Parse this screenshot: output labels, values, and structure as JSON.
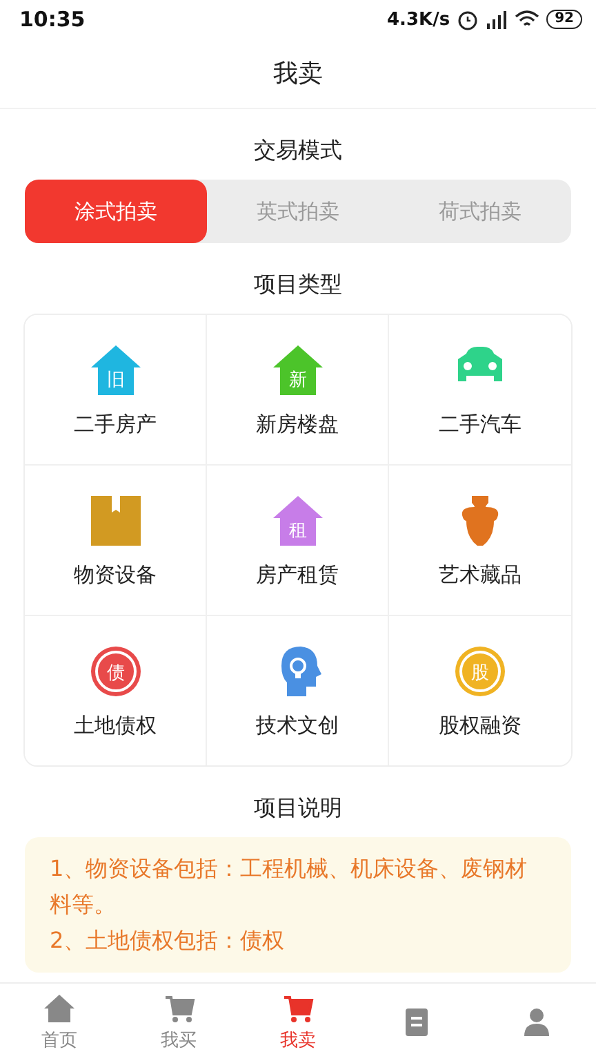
{
  "status_bar": {
    "time": "10:35",
    "speed": "4.3K/s",
    "battery": "92"
  },
  "title": "我卖",
  "mode_section": {
    "title": "交易模式",
    "options": [
      {
        "label": "涂式拍卖",
        "selected": true
      },
      {
        "label": "英式拍卖",
        "selected": false
      },
      {
        "label": "荷式拍卖",
        "selected": false
      }
    ]
  },
  "type_section": {
    "title": "项目类型",
    "items": [
      {
        "label": "二手房产",
        "kind": "house",
        "glyph": "旧",
        "color": "#1fb6e0"
      },
      {
        "label": "新房楼盘",
        "kind": "house",
        "glyph": "新",
        "color": "#4cc42a"
      },
      {
        "label": "二手汽车",
        "kind": "car",
        "color": "#2ed38a"
      },
      {
        "label": "物资设备",
        "kind": "box",
        "color": "#d29a22"
      },
      {
        "label": "房产租赁",
        "kind": "house",
        "glyph": "租",
        "color": "#c77de8"
      },
      {
        "label": "艺术藏品",
        "kind": "vase",
        "color": "#e0731f"
      },
      {
        "label": "土地债权",
        "kind": "ring",
        "glyph": "债",
        "color": "#e84a4a"
      },
      {
        "label": "技术文创",
        "kind": "head",
        "color": "#4a90e2"
      },
      {
        "label": "股权融资",
        "kind": "ring",
        "glyph": "股",
        "color": "#f0b323"
      }
    ]
  },
  "note_section": {
    "title": "项目说明",
    "lines": [
      "1、物资设备包括：工程机械、机床设备、废钢材料等。",
      "2、土地债权包括：债权"
    ]
  },
  "tab_bar": [
    {
      "label": "首页",
      "kind": "home",
      "selected": false
    },
    {
      "label": "我买",
      "kind": "cart",
      "selected": false
    },
    {
      "label": "我卖",
      "kind": "sell",
      "selected": true
    },
    {
      "kind": "doc",
      "selected": false
    },
    {
      "kind": "person",
      "selected": false
    }
  ]
}
